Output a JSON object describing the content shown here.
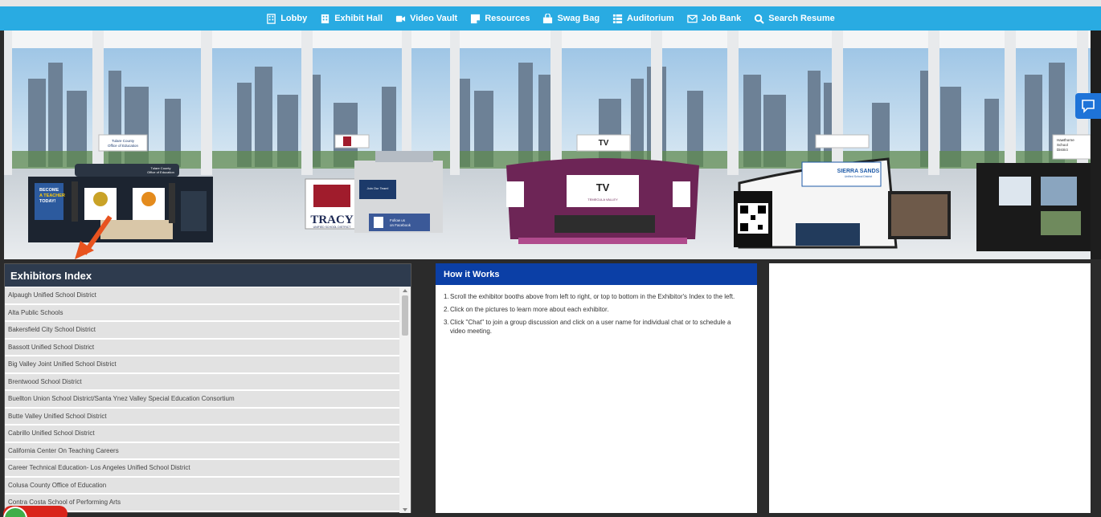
{
  "nav": {
    "items": [
      {
        "label": "Lobby",
        "icon": "building-icon"
      },
      {
        "label": "Exhibit Hall",
        "icon": "building-icon"
      },
      {
        "label": "Video Vault",
        "icon": "video-camera-icon"
      },
      {
        "label": "Resources",
        "icon": "sticky-note-icon"
      },
      {
        "label": "Swag Bag",
        "icon": "shopping-bag-icon"
      },
      {
        "label": "Auditorium",
        "icon": "list-icon"
      },
      {
        "label": "Job Bank",
        "icon": "envelope-icon"
      },
      {
        "label": "Search Resume",
        "icon": "search-icon"
      }
    ]
  },
  "booths": {
    "tulare_sign1": "Tulare County",
    "tulare_sign2": "Office of Education",
    "become1": "BECOME",
    "become2": "A TEACHER",
    "become3": "TODAY!",
    "tracy": "TRACY",
    "tracy_sub": "UNIFIED SCHOOL DISTRICT",
    "join_team": "Join Our Team!",
    "facebook1": "Follow us",
    "facebook2": "on Facebook",
    "tv": "TV",
    "temecula": "TEMECULA VALLEY",
    "sierra1": "SIERRA SANDS",
    "sierra2": "Unified School District",
    "hawthorne1": "Hawthorne",
    "hawthorne2": "School",
    "hawthorne3": "District"
  },
  "exhibitors": {
    "title": "Exhibitors Index",
    "items": [
      "Alpaugh Unified School District",
      "Alta Public Schools",
      "Bakersfield City School District",
      "Bassott Unified School District",
      "Big Valley Joint Unified School District",
      "Brentwood School District",
      "Buellton Union School District/Santa Ynez Valley Special Education Consortium",
      "Butte Valley Unified School District",
      "Cabrillo Unified School District",
      "California Center On Teaching Careers",
      "Career Technical Education- Los Angeles Unified School District",
      "Colusa County Office of Education",
      "Contra Costa School of Performing Arts"
    ]
  },
  "how": {
    "title": "How it Works",
    "steps": [
      "Scroll the exhibitor booths above from left to right, or top to bottom in the Exhibitor's Index to the left.",
      "Click on the pictures to learn more about each exhibitor.",
      "Click \"Chat\" to join a group discussion and click on a user name for individual chat or to schedule a video meeting."
    ],
    "step_numbers": [
      "1.",
      "2.",
      "3."
    ]
  },
  "colors": {
    "nav_bg": "#29abe2",
    "exhibitors_header": "#2e3b4e",
    "how_header": "#0b3fa6",
    "page_bg": "#2b2b2b"
  }
}
